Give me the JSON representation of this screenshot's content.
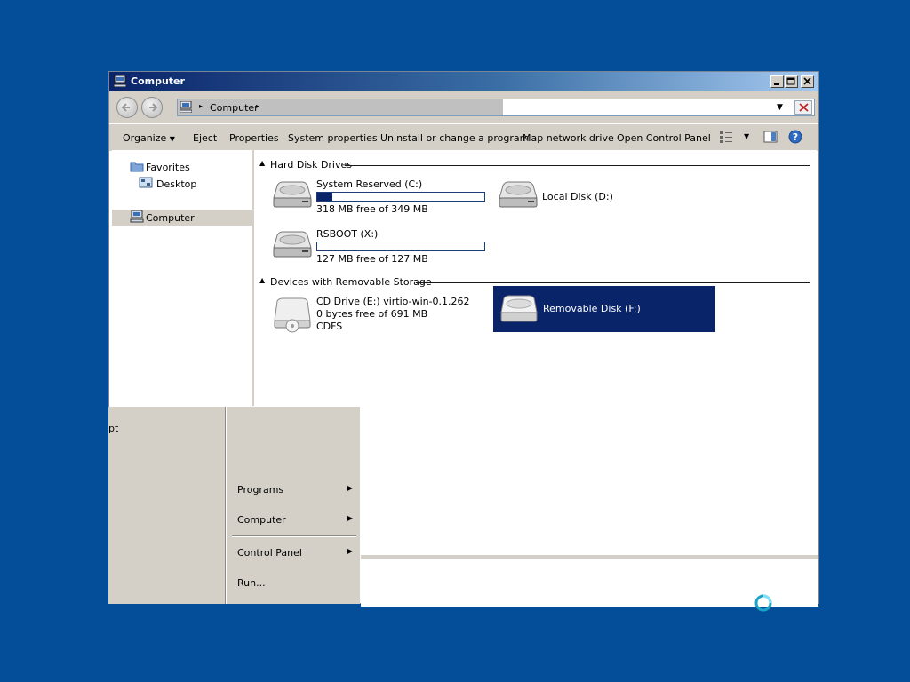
{
  "window": {
    "title": "Computer"
  },
  "address": {
    "crumb": "Computer"
  },
  "toolbar": {
    "organize": "Organize",
    "eject": "Eject",
    "properties": "Properties",
    "system_properties": "System properties",
    "uninstall": "Uninstall or change a program",
    "map_drive": "Map network drive",
    "control_panel": "Open Control Panel"
  },
  "nav": {
    "favorites": "Favorites",
    "desktop": "Desktop",
    "computer": "Computer"
  },
  "groups": {
    "hdd": "Hard Disk Drives",
    "removable": "Devices with Removable Storage"
  },
  "drives": {
    "c": {
      "name": "System Reserved (C:)",
      "free": "318 MB free of 349 MB",
      "used_fraction": 0.09
    },
    "d": {
      "name": "Local Disk (D:)"
    },
    "x": {
      "name": "RSBOOT (X:)",
      "free": "127 MB free of 127 MB",
      "used_fraction": 0.0
    },
    "e": {
      "name": "CD Drive (E:) virtio-win-0.1.262",
      "free": "0 bytes free of 691 MB",
      "fs": "CDFS"
    },
    "f": {
      "name": "Removable Disk (F:)"
    }
  },
  "startmenu": {
    "cut_text": "pt",
    "programs": "Programs",
    "computer": "Computer",
    "control_panel": "Control Panel",
    "run": "Run..."
  },
  "colors": {
    "desktop": "#034d99",
    "selection": "#0a246a",
    "chrome": "#d4d0c8"
  }
}
